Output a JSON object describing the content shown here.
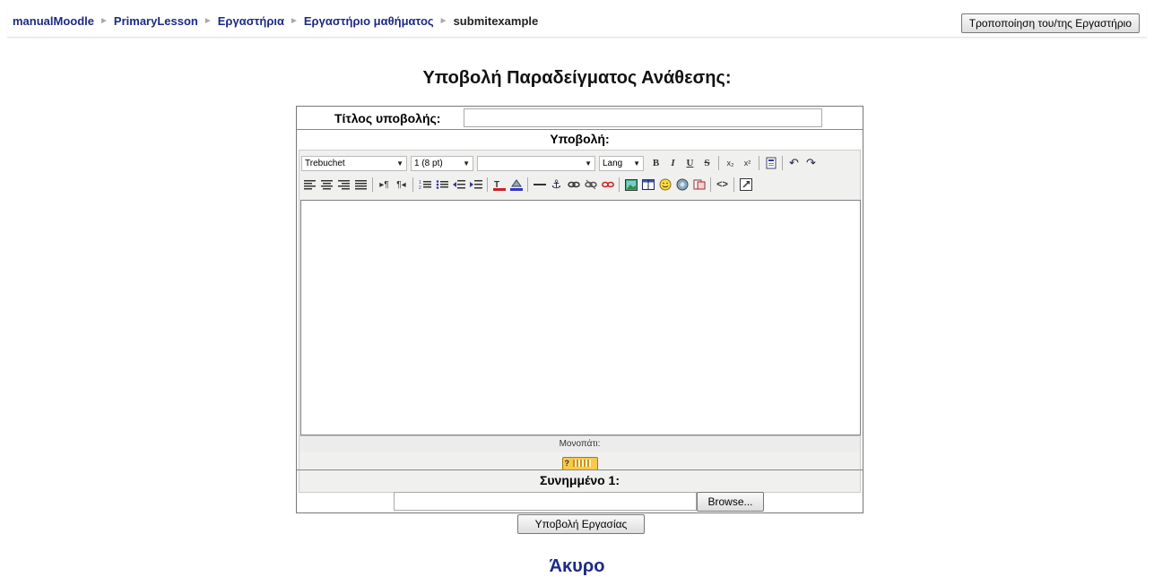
{
  "navbar": {
    "breadcrumb": [
      "manualMoodle",
      "PrimaryLesson",
      "Εργαστήρια",
      "Εργαστήριο μαθήματος",
      "submitexample"
    ],
    "separator": "►",
    "edit_button": "Τροποποίηση του/της Εργαστήριο"
  },
  "page_title": "Υποβολή Παραδείγματος Ανάθεσης:",
  "form": {
    "title_label": "Τίτλος υποβολής:",
    "title_value": "",
    "submission_label": "Υποβολή:",
    "editor": {
      "font_family": "Trebuchet",
      "font_size": "1 (8 pt)",
      "style_value": "",
      "lang": "Lang",
      "path_label": "Μονοπάτι:",
      "help_text": "?",
      "toolbar1": [
        "B",
        "I",
        "U",
        "S",
        "x₂",
        "x²",
        "paste-word",
        "undo",
        "redo"
      ],
      "toolbar2": [
        "justify-left",
        "justify-center",
        "justify-right",
        "justify-full",
        "ltr",
        "rtl",
        "ordered-list",
        "unordered-list",
        "outdent",
        "indent",
        "text-color",
        "bg-color",
        "horizontal-rule",
        "anchor",
        "link",
        "nolink",
        "unlink",
        "image",
        "table",
        "smiley",
        "insert-special",
        "search-replace",
        "html-source",
        "fullscreen"
      ]
    },
    "attachment_label": "Συνημμένο 1:",
    "attachment_value": "",
    "browse_label": "Browse...",
    "submit_label": "Υποβολή Εργασίας"
  },
  "cancel_label": "Άκυρο",
  "colors": {
    "link": "#1d2a85",
    "separator": "#a9a9a9",
    "keyboard_icon": "#f7c94f"
  }
}
